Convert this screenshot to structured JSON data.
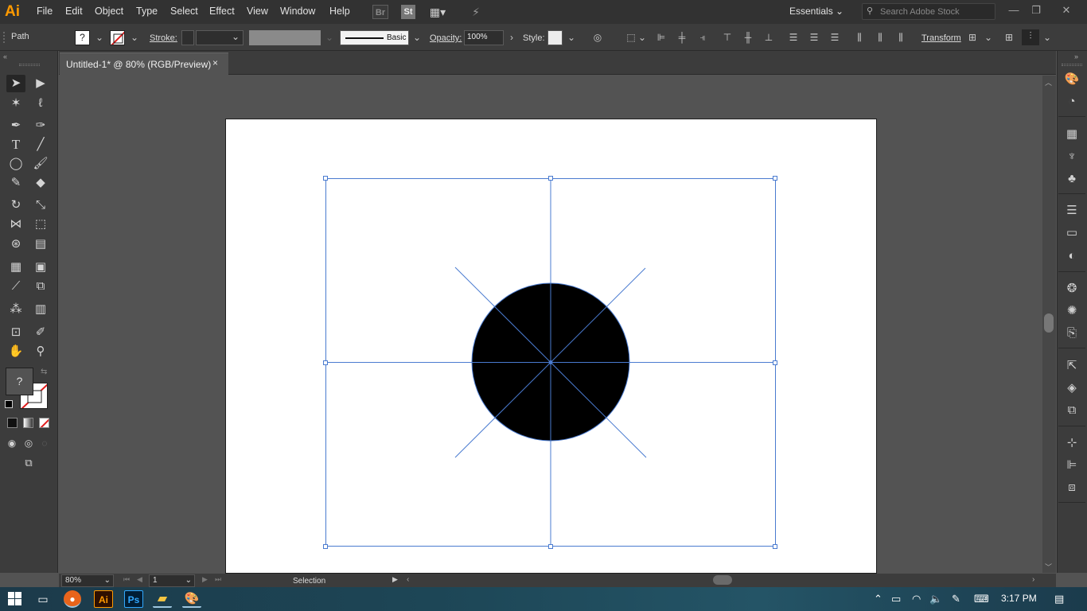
{
  "app": {
    "logo_text": "Ai",
    "menu": [
      "File",
      "Edit",
      "Object",
      "Type",
      "Select",
      "Effect",
      "View",
      "Window",
      "Help"
    ],
    "bridge_label": "Br",
    "stock_label": "St",
    "workspace": "Essentials",
    "search_placeholder": "Search Adobe Stock",
    "window_controls": {
      "minimize": "—",
      "restore": "❐",
      "close": "✕"
    }
  },
  "control_bar": {
    "selection_type": "Path",
    "stroke_label": "Stroke:",
    "brush_label": "Basic",
    "opacity_label": "Opacity:",
    "opacity_value": "100%",
    "style_label": "Style:",
    "transform_label": "Transform",
    "fill_state": "?"
  },
  "document": {
    "tab_title": "Untitled-1* @ 80% (RGB/Preview)",
    "close_glyph": "×"
  },
  "artwork": {
    "circle_fill": "#000000",
    "guide_color": "#4a7bd0"
  },
  "tools": {
    "fill_unknown": "?"
  },
  "status_bar": {
    "zoom": "80%",
    "artboard_number": "1",
    "tool_name": "Selection"
  },
  "taskbar": {
    "apps": [
      "firefox-icon",
      "illustrator-icon",
      "photoshop-icon",
      "file-explorer-icon",
      "paint-icon"
    ],
    "ai_label": "Ai",
    "ps_label": "Ps",
    "time": "3:17 PM"
  },
  "colors": {
    "accent": "#ff9a00",
    "selection_blue": "#4a7bd0"
  }
}
